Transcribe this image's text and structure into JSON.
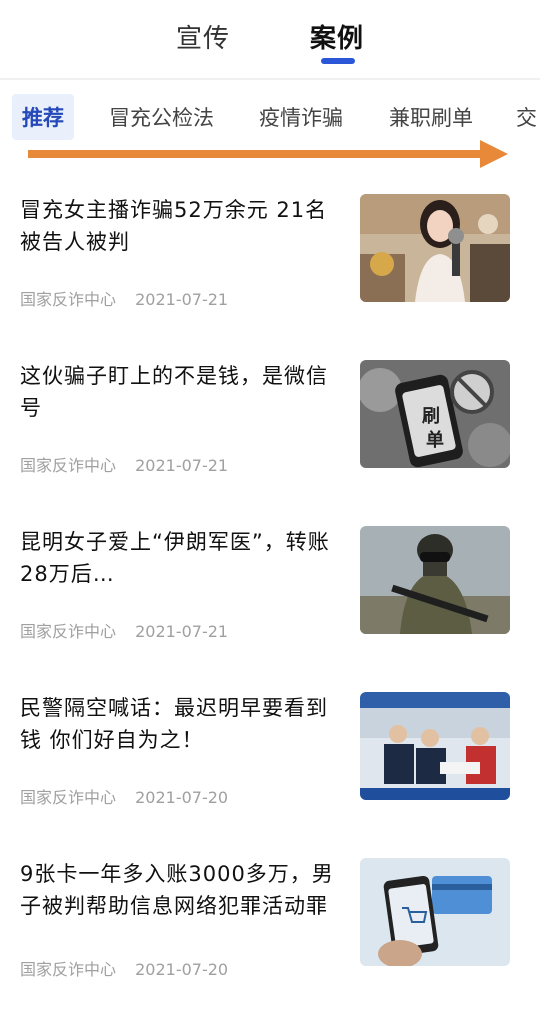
{
  "top_tabs": [
    "宣传",
    "案例"
  ],
  "categories": [
    "推荐",
    "冒充公检法",
    "疫情诈骗",
    "兼职刷单",
    "交"
  ],
  "articles": [
    {
      "title": "冒充女主播诈骗52万余元 21名被告人被判",
      "source": "国家反诈中心",
      "date": "2021-07-21",
      "thumbnail": "female-streamer-photo"
    },
    {
      "title": "这伙骗子盯上的不是钱，是微信号",
      "source": "国家反诈中心",
      "date": "2021-07-21",
      "thumbnail": "phone-ban-photo",
      "thumb_text": [
        "刷",
        "单"
      ]
    },
    {
      "title": "昆明女子爱上“伊朗军医”，转账28万后…",
      "source": "国家反诈中心",
      "date": "2021-07-21",
      "thumbnail": "soldier-photo"
    },
    {
      "title": "民警隔空喊话：最迟明早要看到钱 你们好自为之！",
      "source": "国家反诈中心",
      "date": "2021-07-20",
      "thumbnail": "police-meeting-photo"
    },
    {
      "title": "9张卡一年多入账3000多万，男子被判帮助信息网络犯罪活动罪",
      "source": "国家反诈中心",
      "date": "2021-07-20",
      "thumbnail": "phone-card-photo"
    }
  ],
  "colors": {
    "accent": "#2b56d8",
    "arrow": "#e8893a",
    "meta": "#a0a0a0"
  }
}
